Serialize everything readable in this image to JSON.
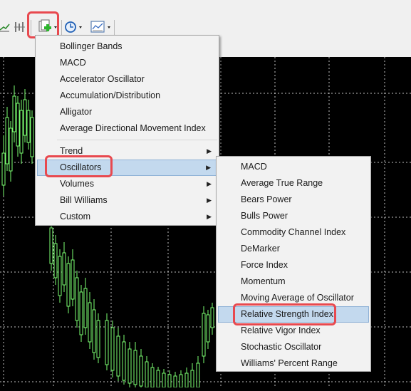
{
  "colors": {
    "highlight": "#e8494f",
    "selected_bg": "#c3d9ee",
    "grid": "#ffffff",
    "candle": "#7cff72"
  },
  "toolbar": {
    "buttons": [
      {
        "icon": "line-chart-icon",
        "dropdown": false
      },
      {
        "icon": "period-separators-icon",
        "dropdown": false
      },
      {
        "icon": "indicators-add-icon",
        "dropdown": true
      },
      {
        "icon": "clock-period-icon",
        "dropdown": true
      },
      {
        "icon": "templates-icon",
        "dropdown": true
      }
    ]
  },
  "indicators_menu": {
    "items": [
      {
        "label": "Bollinger Bands",
        "submenu": false
      },
      {
        "label": "MACD",
        "submenu": false
      },
      {
        "label": "Accelerator Oscillator",
        "submenu": false
      },
      {
        "label": "Accumulation/Distribution",
        "submenu": false
      },
      {
        "label": "Alligator",
        "submenu": false
      },
      {
        "label": "Average Directional Movement Index",
        "submenu": false
      },
      {
        "label": "Trend",
        "submenu": true
      },
      {
        "label": "Oscillators",
        "submenu": true,
        "selected": true
      },
      {
        "label": "Volumes",
        "submenu": true
      },
      {
        "label": "Bill Williams",
        "submenu": true
      },
      {
        "label": "Custom",
        "submenu": true
      }
    ]
  },
  "oscillators_menu": {
    "items": [
      {
        "label": "MACD"
      },
      {
        "label": "Average True Range"
      },
      {
        "label": "Bears Power"
      },
      {
        "label": "Bulls Power"
      },
      {
        "label": "Commodity Channel Index"
      },
      {
        "label": "DeMarker"
      },
      {
        "label": "Force Index"
      },
      {
        "label": "Momentum"
      },
      {
        "label": "Moving Average of Oscillator"
      },
      {
        "label": "Relative Strength Index",
        "selected": true
      },
      {
        "label": "Relative Vigor Index"
      },
      {
        "label": "Stochastic Oscillator"
      },
      {
        "label": "Williams' Percent Range"
      }
    ]
  }
}
